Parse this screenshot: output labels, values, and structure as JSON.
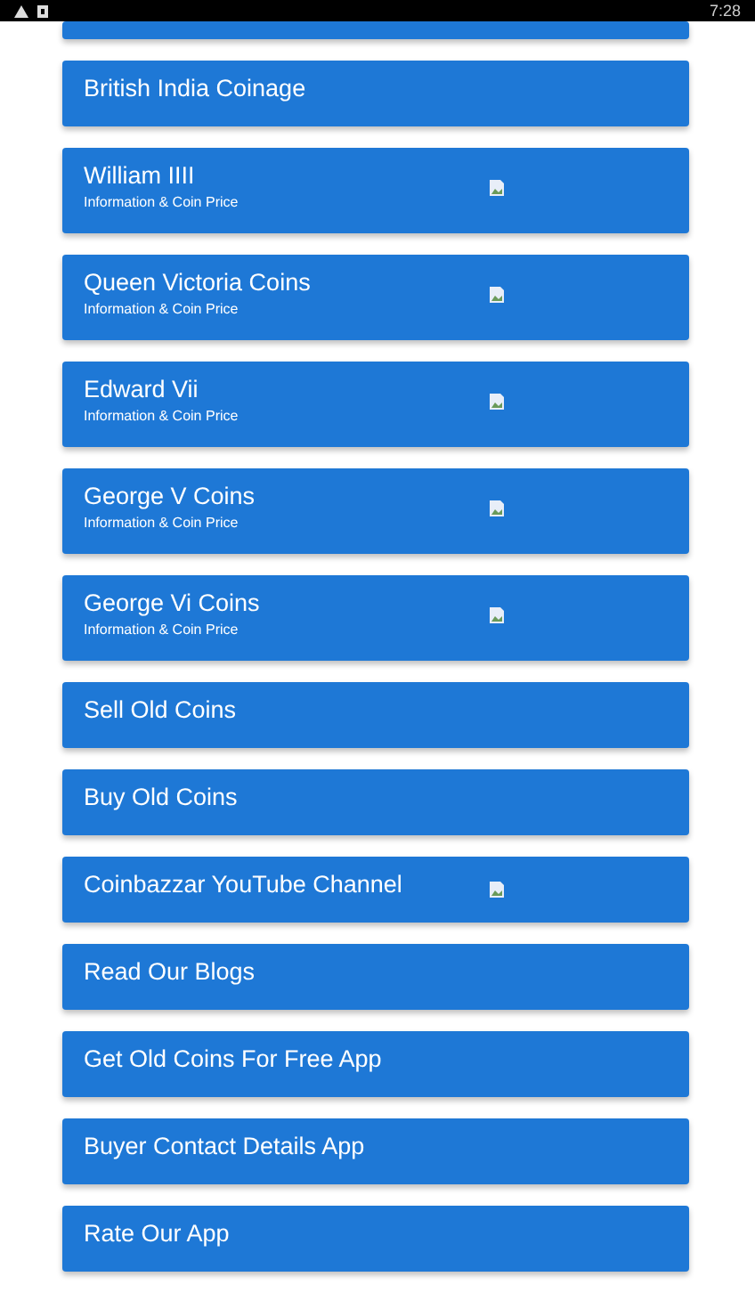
{
  "status_bar": {
    "time": "7:28"
  },
  "menu_items": [
    {
      "kind": "single",
      "title": "British India Coinage",
      "has_image": false
    },
    {
      "kind": "double",
      "title": "William IIII",
      "subtitle": "Information & Coin Price",
      "has_image": true
    },
    {
      "kind": "double",
      "title": "Queen Victoria Coins",
      "subtitle": "Information & Coin Price",
      "has_image": true
    },
    {
      "kind": "double",
      "title": "Edward Vii",
      "subtitle": "Information & Coin Price",
      "has_image": true
    },
    {
      "kind": "double",
      "title": "George V Coins",
      "subtitle": "Information & Coin Price",
      "has_image": true
    },
    {
      "kind": "double",
      "title": "George Vi Coins",
      "subtitle": "Information & Coin Price",
      "has_image": true
    },
    {
      "kind": "single",
      "title": "Sell Old Coins",
      "has_image": false
    },
    {
      "kind": "single",
      "title": "Buy Old Coins",
      "has_image": false
    },
    {
      "kind": "single",
      "title": "Coinbazzar YouTube Channel",
      "has_image": true
    },
    {
      "kind": "single",
      "title": "Read Our Blogs",
      "has_image": false
    },
    {
      "kind": "single",
      "title": "Get Old Coins For Free App",
      "has_image": false
    },
    {
      "kind": "single",
      "title": "Buyer Contact Details App",
      "has_image": false
    },
    {
      "kind": "single",
      "title": "Rate Our App",
      "has_image": false
    }
  ]
}
